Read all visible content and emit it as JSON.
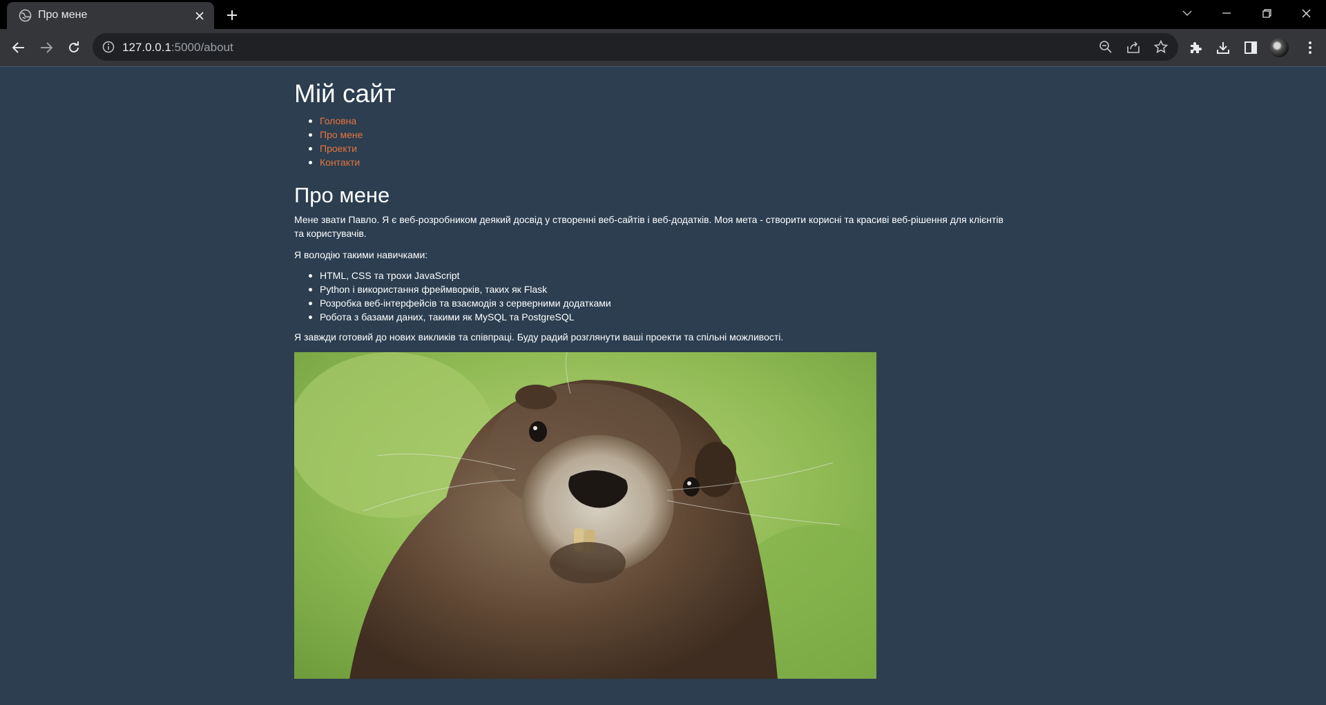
{
  "browser": {
    "tab_title": "Про мене",
    "url_host": "127.0.0.1",
    "url_path": ":5000/about"
  },
  "page": {
    "site_title": "Мій сайт",
    "nav": [
      "Головна",
      "Про мене",
      "Проекти",
      "Контакти"
    ],
    "section_title": "Про мене",
    "intro": "Мене звати Павло. Я є веб-розробником деякий досвід у створенні веб-сайтів і веб-додатків. Моя мета - створити корисні та красиві веб-рішення для клієнтів та користувачів.",
    "skills_intro": "Я володію такими навичками:",
    "skills": [
      "HTML, CSS та трохи JavaScript",
      "Python і використання фреймворків, таких як Flask",
      "Розробка веб-інтерфейсів та взаємодія з серверними додатками",
      "Робота з базами даних, такими як MySQL та PostgreSQL"
    ],
    "closing": "Я завжди готовий до нових викликів та співпраці. Буду радий розглянути ваші проекти та спільні можливості."
  },
  "colors": {
    "page_bg": "#2c3e50",
    "link": "#e8743b",
    "text": "#ffffff"
  },
  "icons": [
    "globe-icon",
    "close-icon",
    "plus-icon",
    "back-icon",
    "forward-icon",
    "reload-icon",
    "info-icon",
    "zoom-icon",
    "share-icon",
    "star-icon",
    "extensions-icon",
    "download-icon",
    "side-panel-icon",
    "avatar"
  ]
}
